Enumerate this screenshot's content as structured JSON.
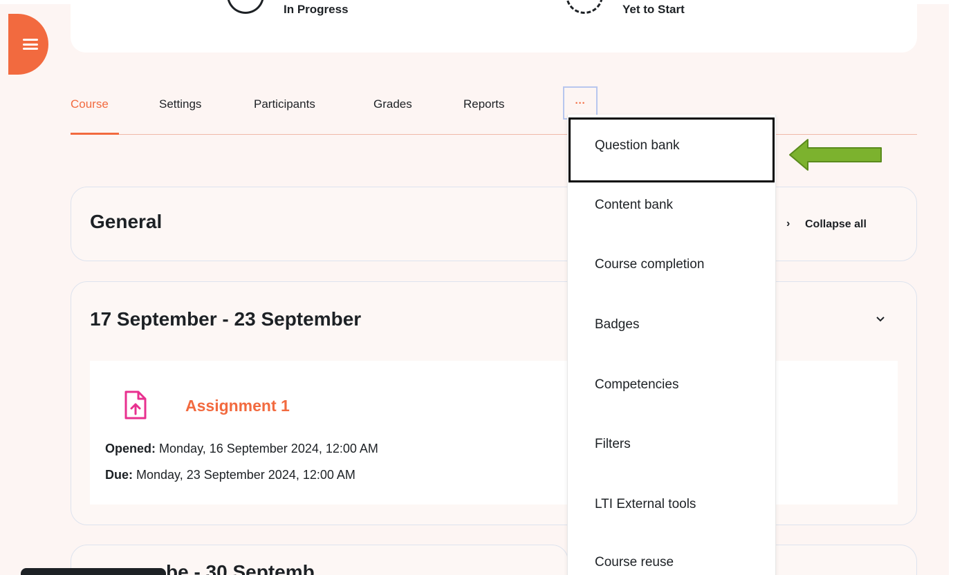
{
  "status": {
    "in_progress": "In Progress",
    "yet_to_start": "Yet to Start"
  },
  "tabs": [
    {
      "label": "Course",
      "active": true
    },
    {
      "label": "Settings"
    },
    {
      "label": "Participants"
    },
    {
      "label": "Grades"
    },
    {
      "label": "Reports"
    }
  ],
  "more_label": "···",
  "sections": {
    "general": {
      "title": "General",
      "collapse_all": "Collapse all"
    },
    "week1": {
      "title": "17 September - 23 September",
      "activity": {
        "name": "Assignment 1",
        "opened_label": "Opened:",
        "opened_value": "Monday, 16 September 2024, 12:00 AM",
        "due_label": "Due:",
        "due_value": "Monday, 23 September 2024, 12:00 AM"
      }
    },
    "week2": {
      "partial_title": "be - 30 Septemb"
    }
  },
  "more_menu": [
    "Question bank",
    "Content bank",
    "Course completion",
    "Badges",
    "Competencies",
    "Filters",
    "LTI External tools",
    "Course reuse"
  ],
  "colors": {
    "accent": "#f26a3f",
    "arrow": "#7cb22e",
    "assign_icon": "#e8308f"
  },
  "icons": {
    "hamburger": "menu-icon",
    "assignment": "file-upload-icon",
    "collapse": "chevron-right-icon",
    "section_toggle": "chevron-down-icon",
    "annotation": "arrow-left-icon"
  }
}
